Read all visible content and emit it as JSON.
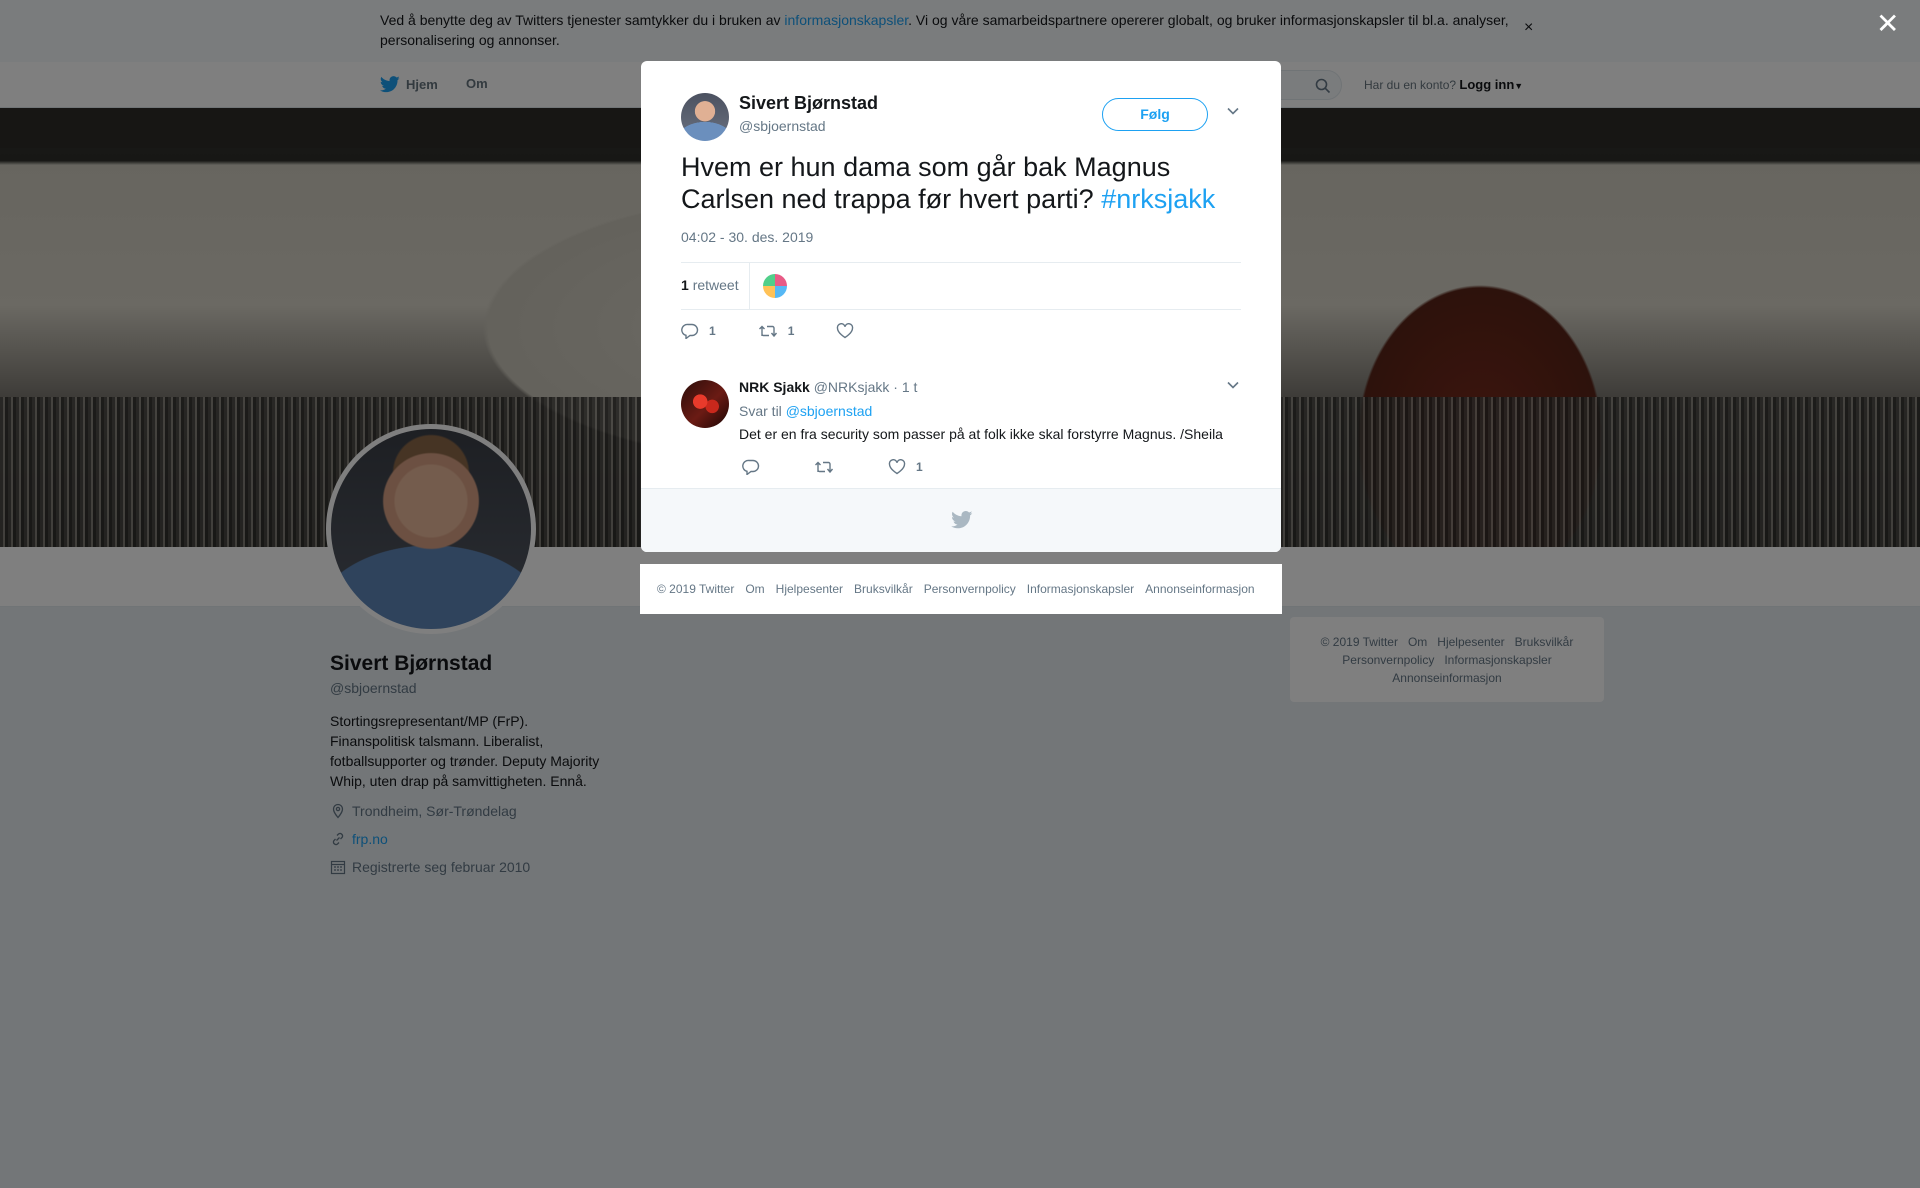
{
  "cookie": {
    "text_before": "Ved å benytte deg av Twitters tjenester samtykker du i bruken av ",
    "link": "informasjonskapsler",
    "text_after": ". Vi og våre samarbeidspartnere opererer globalt, og bruker informasjonskapsler til bl.a. analyser, personalisering og annonser.",
    "close": "×"
  },
  "nav": {
    "home": "Hjem",
    "about": "Om",
    "login_prompt": "Har du en konto?",
    "login": "Logg inn"
  },
  "profile": {
    "name": "Sivert Bjørnstad",
    "handle": "@sbjoernstad",
    "bio": "Stortingsrepresentant/MP (FrP). Finanspolitisk talsmann. Liberalist, fotballsupporter og trønder. Deputy Majority Whip, uten drap på samvittigheten. Ennå.",
    "location": "Trondheim, Sør-Trøndelag",
    "website": "frp.no",
    "joined": "Registrerte seg februar 2010"
  },
  "side_footer": {
    "items": [
      "© 2019 Twitter",
      "Om",
      "Hjelpesenter",
      "Bruksvilkår",
      "Personvernpolicy",
      "Informasjonskapsler",
      "Annonseinformasjon"
    ]
  },
  "overlay": {
    "close": "✕"
  },
  "tweet": {
    "author_name": "Sivert Bjørnstad",
    "author_handle": "@sbjoernstad",
    "follow_label": "Følg",
    "text": "Hvem er hun dama som går bak Magnus Carlsen ned trappa før hvert parti?",
    "hashtag": "#nrksjakk",
    "timestamp": "04:02 - 30. des. 2019",
    "retweet_count": "1",
    "retweet_label": "retweet",
    "reply_count": "1",
    "retweet_action_count": "1",
    "like_count": ""
  },
  "reply": {
    "name": "NRK Sjakk",
    "handle": "@NRKsjakk",
    "time": "· 1 t",
    "reply_to_label": "Svar til",
    "reply_to_handle": "@sbjoernstad",
    "text": "Det er en fra security som passer på at folk ikke skal forstyrre Magnus. /Sheila",
    "reply_count": "",
    "retweet_count": "",
    "like_count": "1"
  },
  "modal_footer": {
    "items": [
      "© 2019 Twitter",
      "Om",
      "Hjelpesenter",
      "Bruksvilkår",
      "Personvernpolicy",
      "Informasjonskapsler",
      "Annonseinformasjon"
    ]
  },
  "colors": {
    "accent": "#1da1f2",
    "text": "#14171a",
    "muted": "#657786",
    "overlay": "rgba(0,0,0,0.5)"
  }
}
